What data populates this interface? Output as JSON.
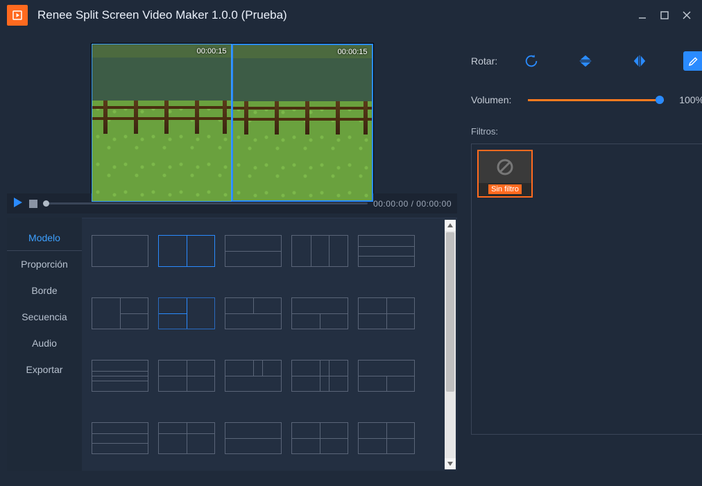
{
  "title": "Renee Split Screen Video Maker 1.0.0 (Prueba)",
  "preview": {
    "left_timestamp": "00:00:15",
    "right_timestamp": "00:00:15"
  },
  "player": {
    "position": "00:00:00",
    "duration": "00:00:00",
    "timecode": "00:00:00 / 00:00:00"
  },
  "side_tabs": {
    "items": [
      {
        "id": "modelo",
        "label": "Modelo",
        "selected": true
      },
      {
        "id": "proporcion",
        "label": "Proporción",
        "selected": false
      },
      {
        "id": "borde",
        "label": "Borde",
        "selected": false
      },
      {
        "id": "secuencia",
        "label": "Secuencia",
        "selected": false
      },
      {
        "id": "audio",
        "label": "Audio",
        "selected": false
      },
      {
        "id": "exportar",
        "label": "Exportar",
        "selected": false
      }
    ]
  },
  "rotate": {
    "label": "Rotar:"
  },
  "volume": {
    "label": "Volumen:",
    "value": 100,
    "display": "100%"
  },
  "filters": {
    "label": "Filtros:",
    "items": [
      {
        "id": "none",
        "label": "Sin filtro",
        "selected": true
      }
    ]
  }
}
